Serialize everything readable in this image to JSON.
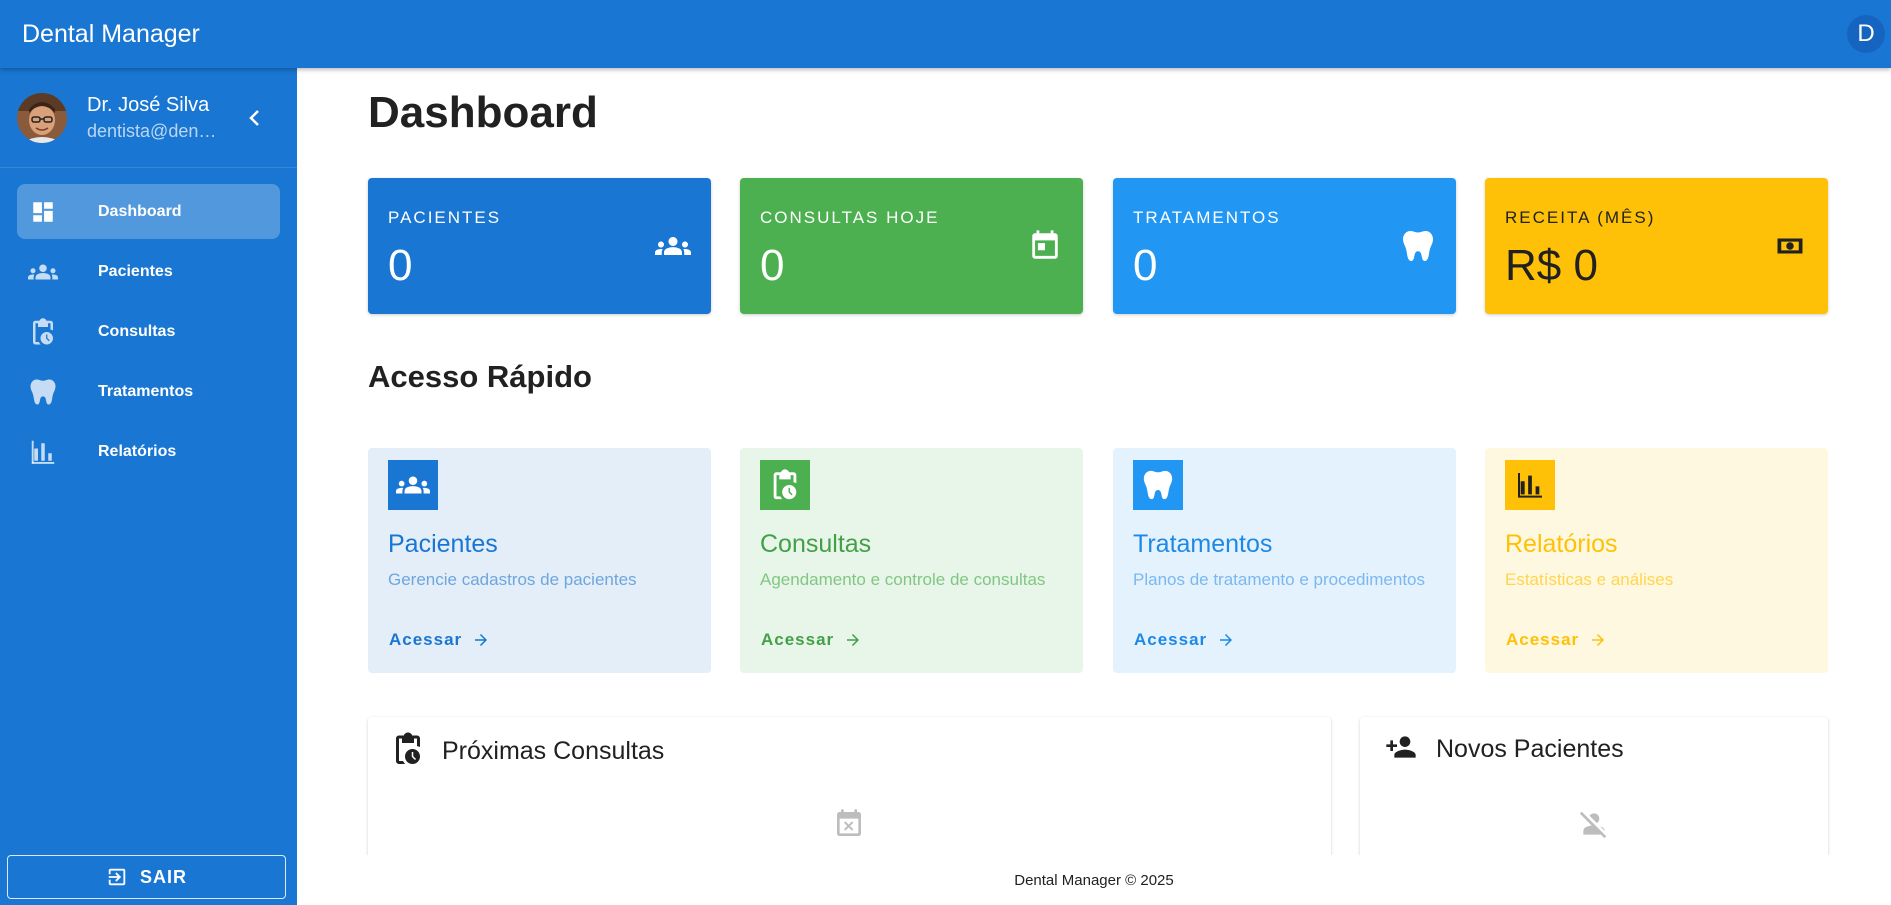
{
  "app": {
    "title": "Dental Manager",
    "avatar_letter": "D"
  },
  "sidebar": {
    "user": {
      "name": "Dr. José Silva",
      "email": "dentista@den…"
    },
    "items": [
      {
        "label": "Dashboard",
        "icon": "dashboard-icon",
        "active": true
      },
      {
        "label": "Pacientes",
        "icon": "people-icon",
        "active": false
      },
      {
        "label": "Consultas",
        "icon": "calendar-clock-icon",
        "active": false
      },
      {
        "label": "Tratamentos",
        "icon": "tooth-icon",
        "active": false
      },
      {
        "label": "Relatórios",
        "icon": "bar-chart-icon",
        "active": false
      }
    ],
    "logout_label": "SAIR"
  },
  "page": {
    "title": "Dashboard"
  },
  "stats": [
    {
      "label": "PACIENTES",
      "value": "0",
      "icon": "people-icon",
      "color": "#1976d2"
    },
    {
      "label": "CONSULTAS HOJE",
      "value": "0",
      "icon": "calendar-today-icon",
      "color": "#4caf50"
    },
    {
      "label": "TRATAMENTOS",
      "value": "0",
      "icon": "tooth-icon",
      "color": "#2196f3"
    },
    {
      "label": "RECEITA (MÊS)",
      "value": "R$ 0",
      "icon": "money-icon",
      "color": "#ffc107"
    }
  ],
  "quick_access": {
    "title": "Acesso Rápido",
    "cards": [
      {
        "title": "Pacientes",
        "description": "Gerencie cadastros de pacientes",
        "link": "Acessar",
        "icon": "people-icon",
        "color": "#1976d2",
        "bg": "#e3eef8"
      },
      {
        "title": "Consultas",
        "description": "Agendamento e controle de consultas",
        "link": "Acessar",
        "icon": "calendar-clock-icon",
        "color": "#4caf50",
        "bg": "#e8f5e9"
      },
      {
        "title": "Tratamentos",
        "description": "Planos de tratamento e procedimentos",
        "link": "Acessar",
        "icon": "tooth-icon",
        "color": "#2196f3",
        "bg": "#e3f2fd"
      },
      {
        "title": "Relatórios",
        "description": "Estatísticas e análises",
        "link": "Acessar",
        "icon": "bar-chart-icon",
        "color": "#ffc107",
        "bg": "#fff8e1"
      }
    ]
  },
  "panels": {
    "upcoming": {
      "title": "Próximas Consultas",
      "icon": "calendar-clock-icon",
      "empty_icon": "calendar-remove-icon"
    },
    "new_patients": {
      "title": "Novos Pacientes",
      "icon": "person-add-icon",
      "empty_icon": "person-off-icon"
    }
  },
  "footer": {
    "text": "Dental Manager © 2025"
  }
}
